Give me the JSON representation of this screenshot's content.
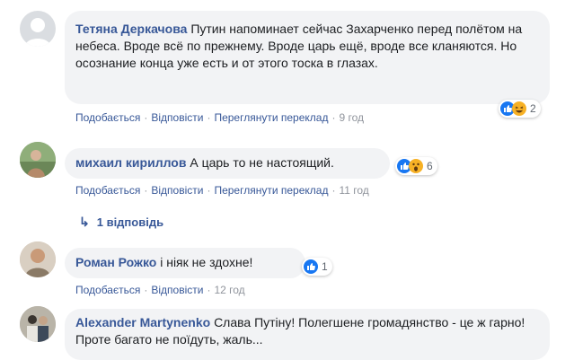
{
  "comments": [
    {
      "author": "Тетяна Деркачова",
      "text": "Путин напоминает сейчас Захарченко перед полётом на небеса. Вроде всё по прежнему. Вроде царь ещё, вроде все кланяются. Но осознание конца уже есть и от этого тоска в глазах.",
      "like": "Подобається",
      "reply": "Відповісти",
      "translate": "Переглянути переклад",
      "time": "9 год",
      "reactions": [
        "like",
        "haha"
      ],
      "reaction_count": "2"
    },
    {
      "author": "михаил кириллов",
      "text": "А царь то не настоящий.",
      "like": "Подобається",
      "reply": "Відповісти",
      "translate": "Переглянути переклад",
      "time": "11 год",
      "reactions": [
        "like",
        "wow"
      ],
      "reaction_count": "6",
      "replies_label": "1 відповідь"
    },
    {
      "author": "Роман Рожко",
      "text": "і ніяк не здохне!",
      "like": "Подобається",
      "reply": "Відповісти",
      "time": "12 год",
      "reactions": [
        "like"
      ],
      "reaction_count": "1"
    },
    {
      "author": "Alexander Martynenko",
      "text": "Слава Путіну! Полегшене громадянство - це ж гарно! Проте багато не поїдуть, жаль..."
    }
  ],
  "colors": {
    "link": "#385898",
    "bubble": "#f2f3f5",
    "meta": "#90949c",
    "like": "#1877f2",
    "emoji": "#f7b125"
  }
}
